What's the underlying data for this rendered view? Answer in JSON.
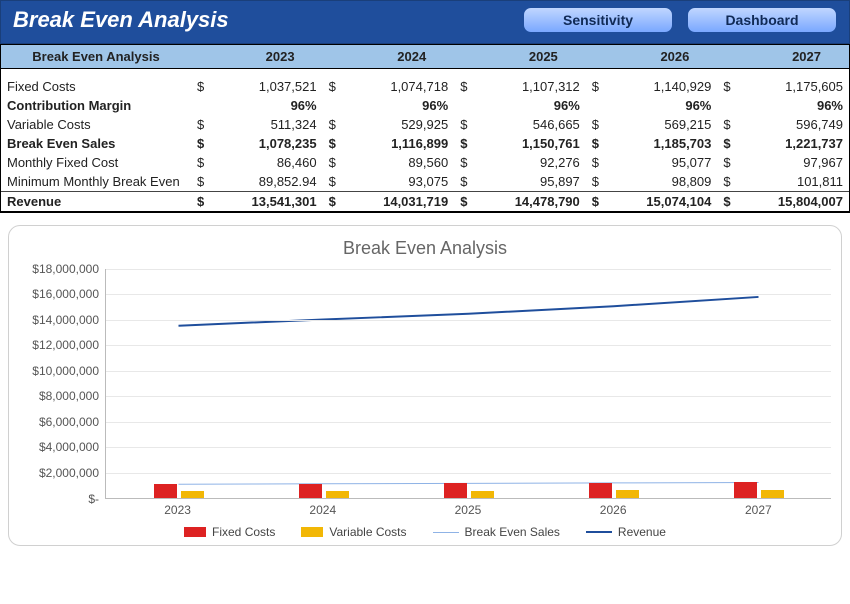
{
  "header": {
    "title": "Break Even Analysis",
    "buttons": {
      "sensitivity": "Sensitivity",
      "dashboard": "Dashboard"
    }
  },
  "table": {
    "header_label": "Break Even Analysis",
    "years": [
      "2023",
      "2024",
      "2025",
      "2026",
      "2027"
    ],
    "rows": [
      {
        "label": "Fixed Costs",
        "bold": false,
        "cur": "$",
        "values": [
          "1,037,521",
          "1,074,718",
          "1,107,312",
          "1,140,929",
          "1,175,605"
        ]
      },
      {
        "label": "Contribution Margin",
        "bold": true,
        "cur": "",
        "values": [
          "96%",
          "96%",
          "96%",
          "96%",
          "96%"
        ]
      },
      {
        "label": "Variable Costs",
        "bold": false,
        "cur": "$",
        "values": [
          "511,324",
          "529,925",
          "546,665",
          "569,215",
          "596,749"
        ]
      },
      {
        "label": "Break Even Sales",
        "bold": true,
        "cur": "$",
        "values": [
          "1,078,235",
          "1,116,899",
          "1,150,761",
          "1,185,703",
          "1,221,737"
        ]
      },
      {
        "label": "Monthly Fixed Cost",
        "bold": false,
        "cur": "$",
        "values": [
          "86,460",
          "89,560",
          "92,276",
          "95,077",
          "97,967"
        ]
      },
      {
        "label": "Minimum Monthly Break Even",
        "bold": false,
        "cur": "$",
        "values": [
          "89,852.94",
          "93,075",
          "95,897",
          "98,809",
          "101,811"
        ]
      },
      {
        "label": "Revenue",
        "bold": true,
        "cur": "$",
        "values": [
          "13,541,301",
          "14,031,719",
          "14,478,790",
          "15,074,104",
          "15,804,007"
        ]
      }
    ]
  },
  "chart_data": {
    "type": "combo",
    "title": "Break Even Analysis",
    "categories": [
      "2023",
      "2024",
      "2025",
      "2026",
      "2027"
    ],
    "ylim": [
      0,
      18000000
    ],
    "yticks": [
      "$-",
      "$2,000,000",
      "$4,000,000",
      "$6,000,000",
      "$8,000,000",
      "$10,000,000",
      "$12,000,000",
      "$14,000,000",
      "$16,000,000",
      "$18,000,000"
    ],
    "series": [
      {
        "name": "Fixed Costs",
        "type": "bar",
        "color": "#d22",
        "values": [
          1037521,
          1074718,
          1107312,
          1140929,
          1175605
        ]
      },
      {
        "name": "Variable Costs",
        "type": "bar",
        "color": "#f2b705",
        "values": [
          511324,
          529925,
          546665,
          569215,
          596749
        ]
      },
      {
        "name": "Break Even Sales",
        "type": "line",
        "color": "#8fb3e6",
        "values": [
          1078235,
          1116899,
          1150761,
          1185703,
          1221737
        ]
      },
      {
        "name": "Revenue",
        "type": "line",
        "color": "#1f4e9c",
        "values": [
          13541301,
          14031719,
          14478790,
          15074104,
          15804007
        ]
      }
    ],
    "legend": [
      "Fixed Costs",
      "Variable Costs",
      "Break Even Sales",
      "Revenue"
    ]
  }
}
